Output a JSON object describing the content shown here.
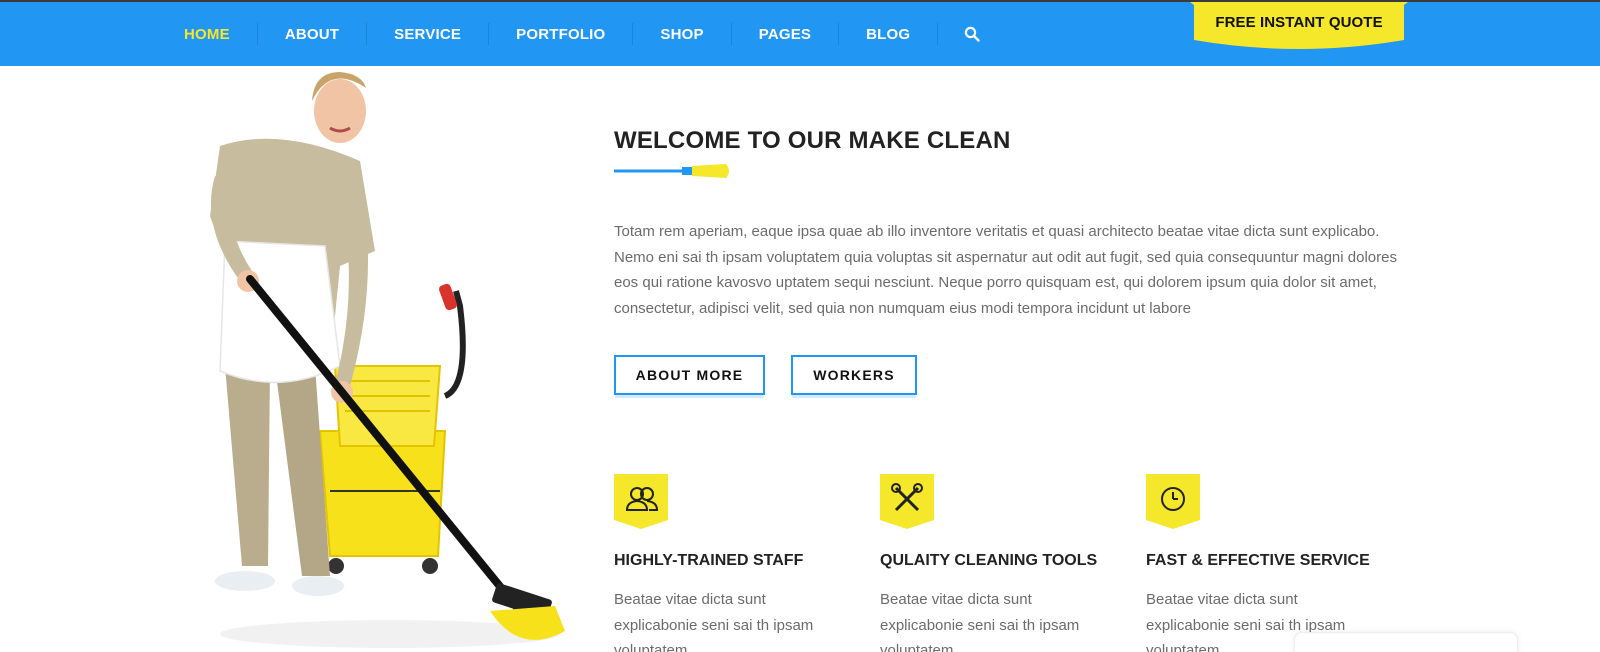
{
  "nav": {
    "items": [
      {
        "label": "HOME",
        "active": true
      },
      {
        "label": "ABOUT"
      },
      {
        "label": "SERVICE"
      },
      {
        "label": "PORTFOLIO"
      },
      {
        "label": "SHOP"
      },
      {
        "label": "PAGES"
      },
      {
        "label": "BLOG"
      }
    ],
    "search_icon": "search-icon",
    "quote_label": "FREE INSTANT QUOTE"
  },
  "colors": {
    "primary_blue": "#2196f3",
    "accent_yellow": "#f5e72a",
    "heading": "#222222",
    "body_text": "#6b6b6b"
  },
  "welcome": {
    "title": "WELCOME TO OUR MAKE CLEAN",
    "text": "Totam rem aperiam, eaque ipsa quae ab illo inventore veritatis et quasi architecto beatae vitae dicta sunt explicabo. Nemo eni sai th ipsam voluptatem quia voluptas sit aspernatur aut odit aut fugit, sed quia consequuntur magni dolores eos qui ratione kavosvo uptatem sequi nesciunt. Neque porro quisquam est, qui dolorem ipsum quia dolor sit amet, consectetur, adipisci velit, sed quia non numquam eius modi tempora incidunt ut labore",
    "buttons": {
      "about_more": "ABOUT MORE",
      "workers": "WORKERS"
    }
  },
  "features": [
    {
      "icon": "staff-icon",
      "title": "HIGHLY-TRAINED STAFF",
      "text": "Beatae vitae dicta sunt explicabonie seni sai th ipsam voluptatem"
    },
    {
      "icon": "tools-icon",
      "title": "QULAITY CLEANING TOOLS",
      "text": "Beatae vitae dicta sunt explicabonie seni sai th ipsam voluptatem"
    },
    {
      "icon": "clock-icon",
      "title": "FAST & EFFECTIVE SERVICE",
      "text": "Beatae vitae dicta sunt explicabonie seni sai th ipsam voluptatem"
    }
  ]
}
